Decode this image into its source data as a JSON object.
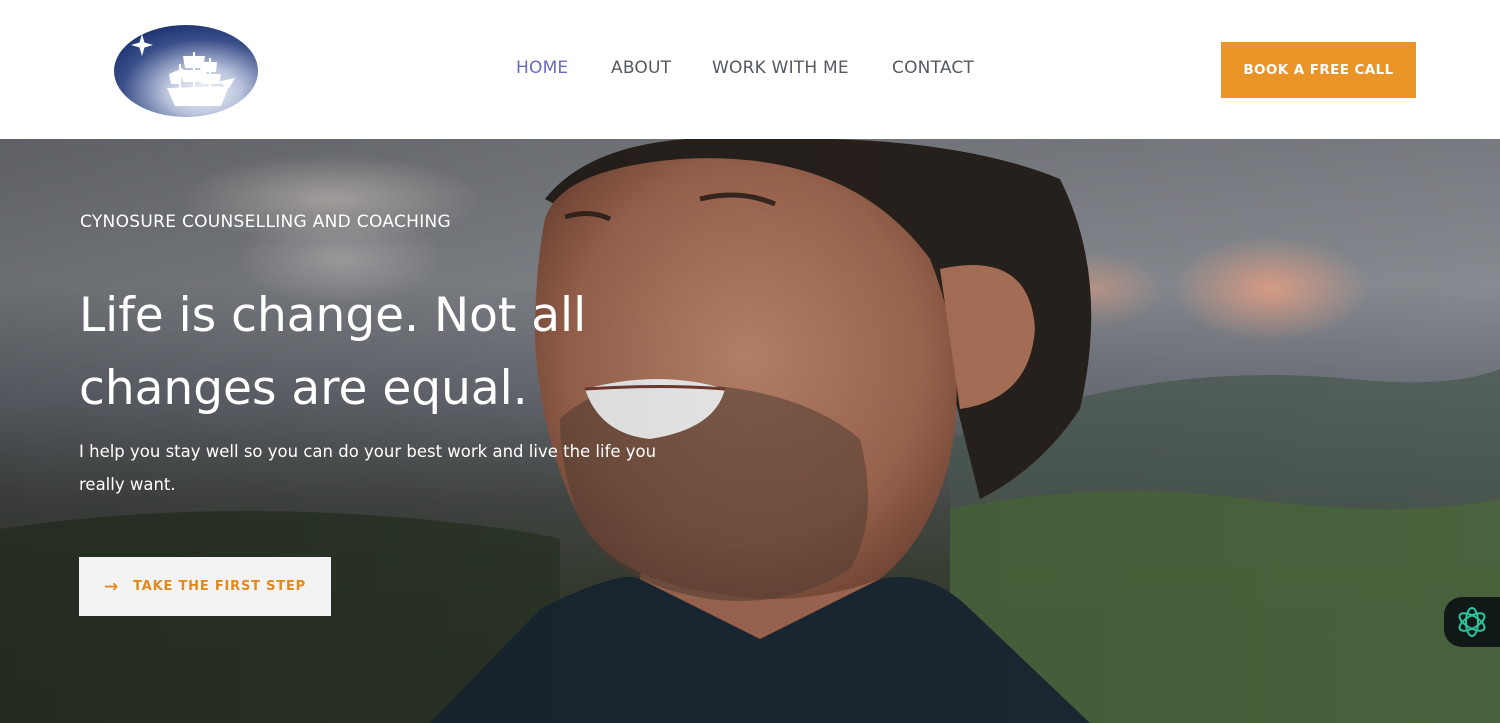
{
  "header": {
    "logo": {
      "icon": "ship-star-logo",
      "colors": {
        "navy": "#1e3370",
        "light": "#f2f4fa"
      }
    },
    "nav": [
      {
        "label": "HOME",
        "active": true
      },
      {
        "label": "ABOUT",
        "active": false
      },
      {
        "label": "WORK WITH ME",
        "active": false
      },
      {
        "label": "CONTACT",
        "active": false
      }
    ],
    "cta_label": "BOOK A FREE CALL"
  },
  "hero": {
    "eyebrow": "CYNOSURE COUNSELLING AND COACHING",
    "headline_line1": "Life is change. Not all",
    "headline_line2": "changes are equal.",
    "subtitle_line1": "I help you stay well so you can do your best work and live the life you",
    "subtitle_line2": "really want.",
    "button_label": "TAKE THE FIRST STEP",
    "button_icon": "arrow-right-icon",
    "background_image": "smiling-man-outdoors-photo"
  },
  "widget": {
    "icon": "assistant-sparkle-icon"
  },
  "colors": {
    "accent": "#ea9428",
    "nav_active": "#6a6ac0",
    "nav": "#555a61",
    "hero_button_text": "#e08a1e"
  }
}
